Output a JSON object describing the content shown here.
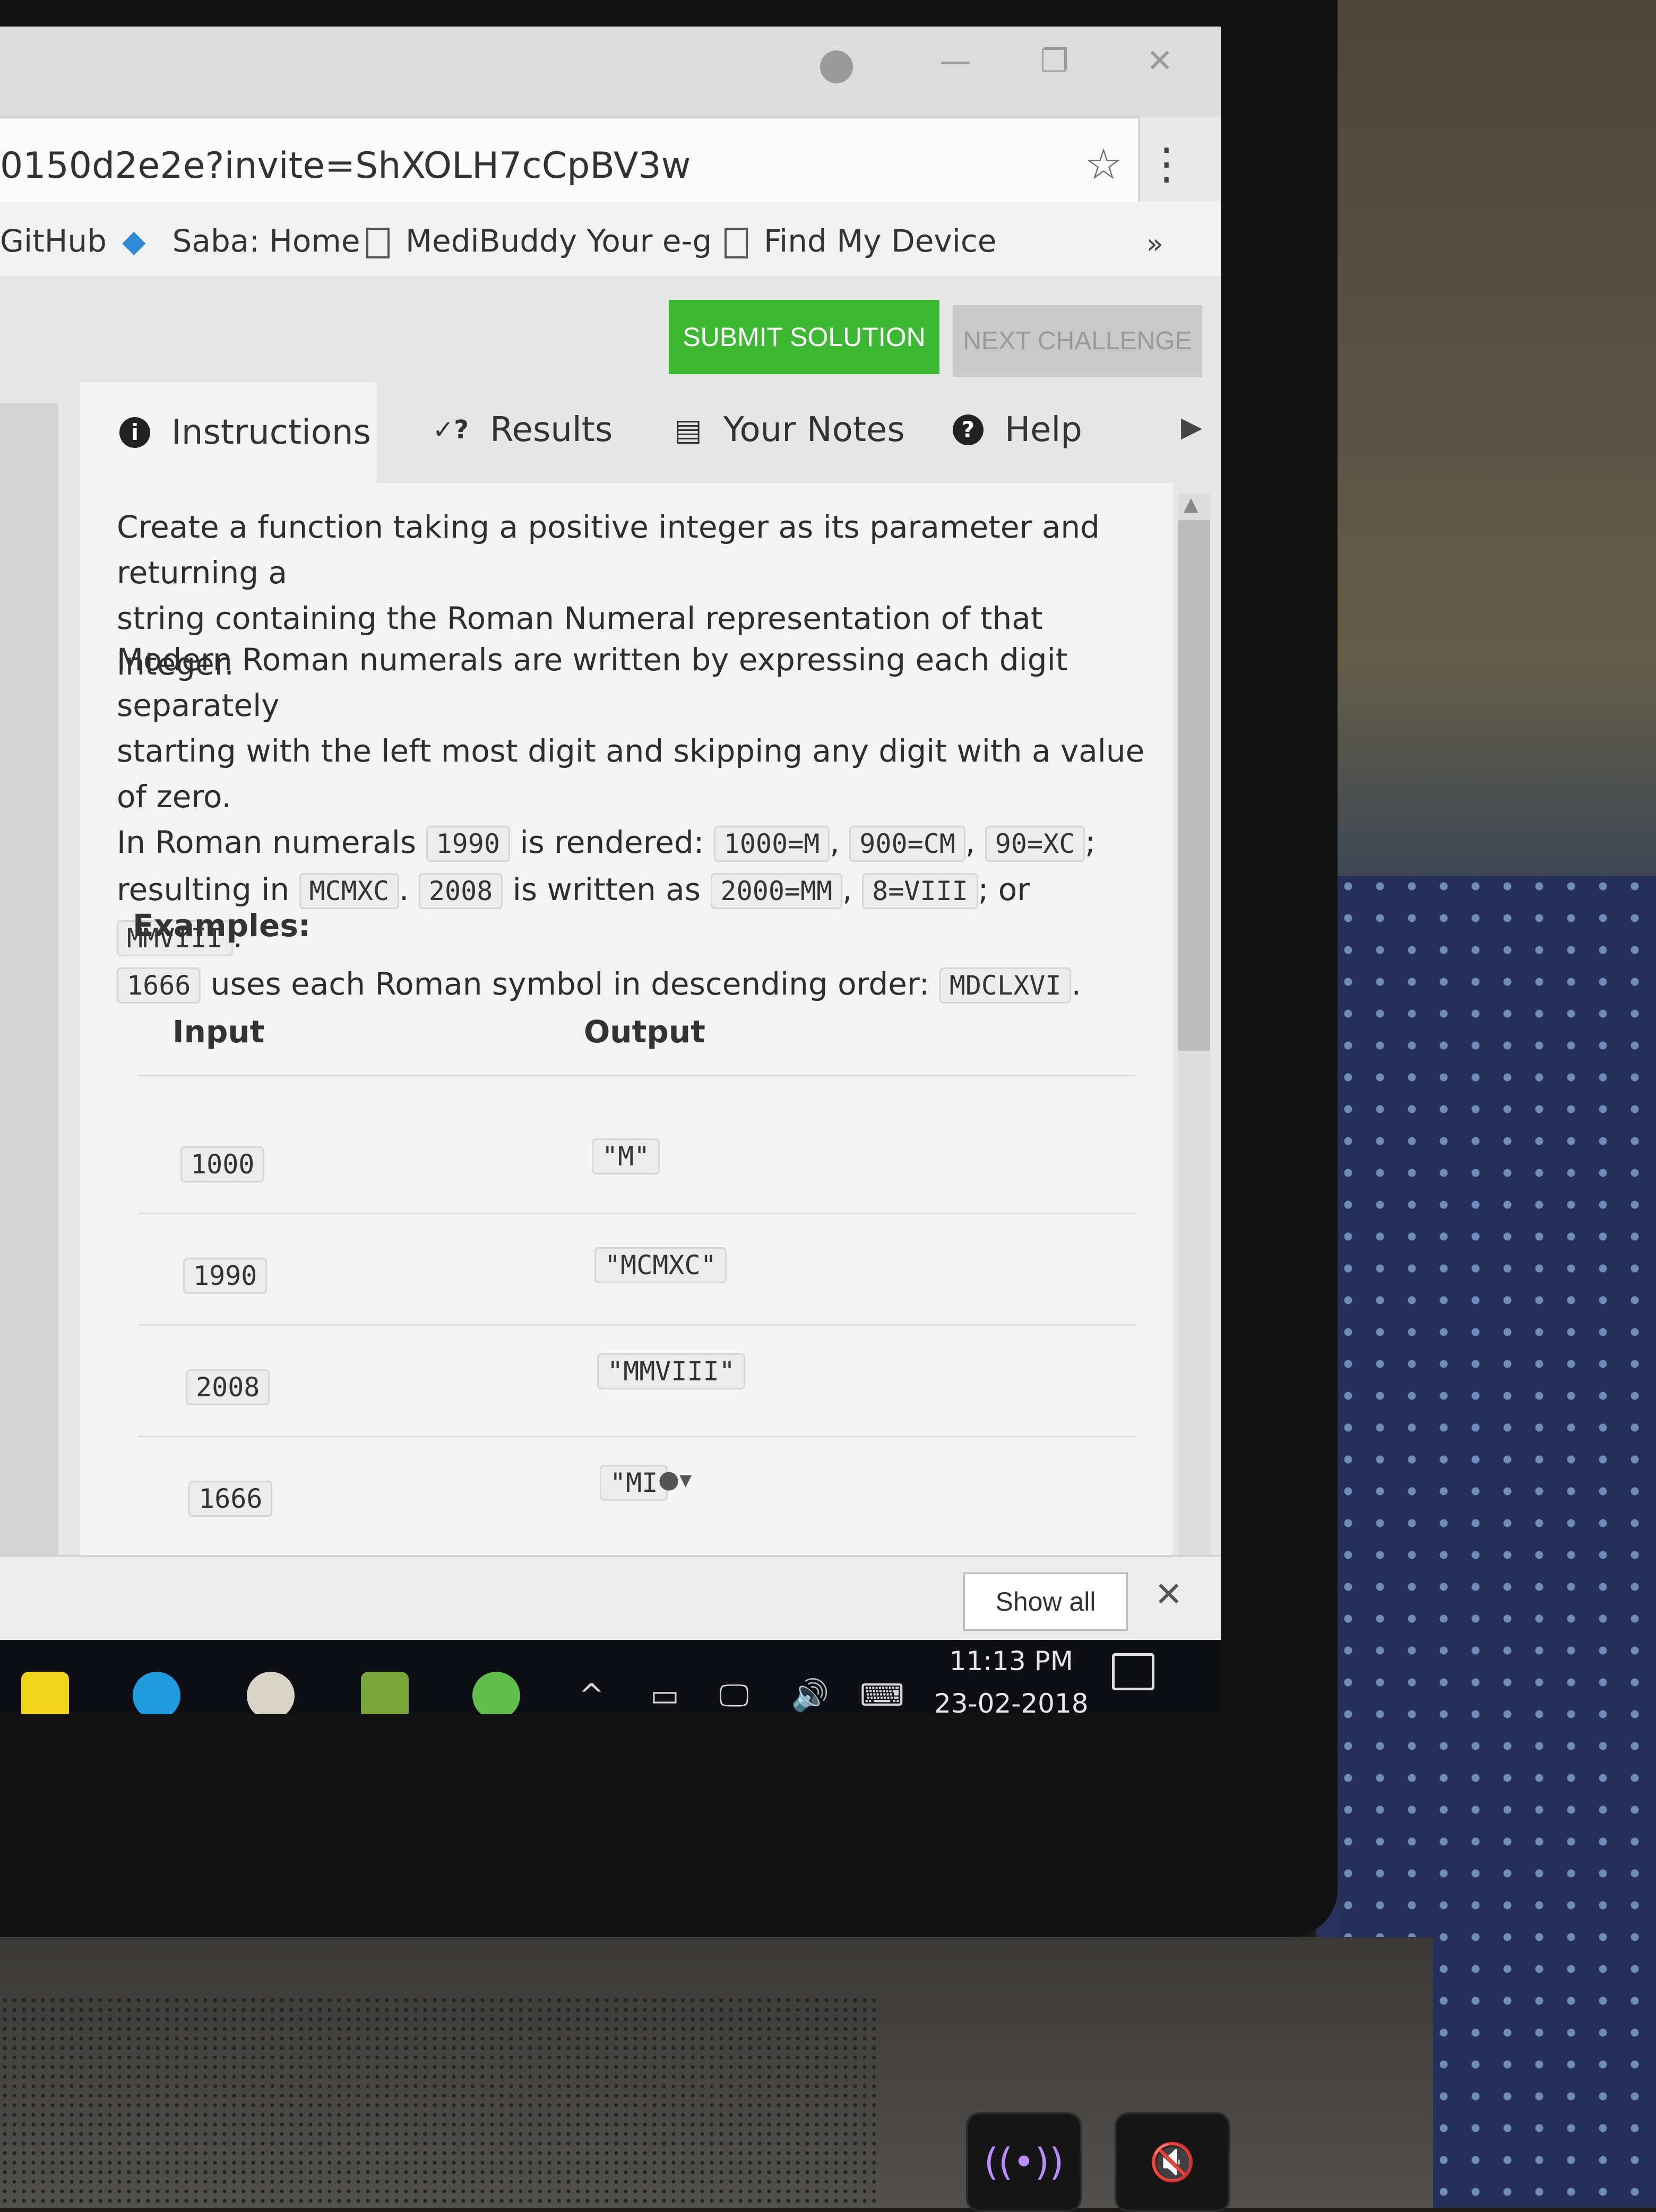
{
  "browser": {
    "url": "0150d2e2e?invite=ShXOLH7cCpBV3w",
    "bookmarks": [
      {
        "label": "GitHub"
      },
      {
        "label": "Saba: Home"
      },
      {
        "label": "MediBuddy Your e-g"
      },
      {
        "label": "Find My Device"
      }
    ],
    "bookmarks_more": "»"
  },
  "toolbar": {
    "submit_label": "SUBMIT SOLUTION",
    "next_label": "NEXT CHALLENGE"
  },
  "tabs": [
    {
      "label": "Instructions",
      "icon": "info-icon",
      "glyph": "i"
    },
    {
      "label": "Results",
      "icon": "check-question-icon",
      "glyph": "✓?"
    },
    {
      "label": "Your Notes",
      "icon": "notes-icon",
      "glyph": "▤"
    },
    {
      "label": "Help",
      "icon": "help-icon",
      "glyph": "?"
    }
  ],
  "instructions": {
    "para1_line1": "Create a function taking a positive integer as its parameter and returning a",
    "para1_line2": "string containing the Roman Numeral representation of that integer.",
    "p2_l1": "Modern Roman numerals are written by expressing each digit separately",
    "p2_l2": "starting with the left most digit and skipping any digit with a value of zero.",
    "p2_l3_a": "In Roman numerals",
    "p2_l3_c1": "1990",
    "p2_l3_b": "is rendered:",
    "p2_l3_c2": "1000=M",
    "p2_l3_c3": "900=CM",
    "p2_l3_c4": "90=XC",
    "p2_l4_a": "resulting in",
    "p2_l4_c1": "MCMXC",
    "p2_l4_c2": "2008",
    "p2_l4_b": "is written as",
    "p2_l4_c3": "2000=MM",
    "p2_l4_c4": "8=VIII",
    "p2_l4_d": "; or",
    "p2_l4_c5": "MMVIII",
    "p2_l5_c1": "1666",
    "p2_l5_b": "uses each Roman symbol in descending order:",
    "p2_l5_c2": "MDCLXVI",
    "examples_label": "Examples:"
  },
  "examples_table": {
    "headers": [
      "Input",
      "Output"
    ],
    "rows": [
      {
        "input": "1000",
        "output": "\"M\""
      },
      {
        "input": "1990",
        "output": "\"MCMXC\""
      },
      {
        "input": "2008",
        "output": "\"MMVIII\""
      },
      {
        "input": "1666",
        "output": "\"MI"
      }
    ]
  },
  "download_bar": {
    "show_all": "Show all",
    "close": "✕"
  },
  "taskbar": {
    "time": "11:13 PM",
    "date": "23-02-2018"
  },
  "colors": {
    "submit": "#3cb833",
    "next": "#c9c9c9"
  }
}
